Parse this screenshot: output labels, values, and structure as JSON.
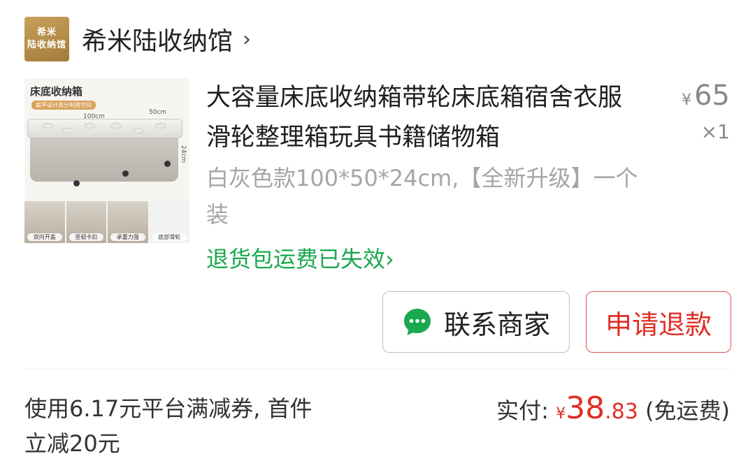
{
  "shop": {
    "logo_line1": "希米",
    "logo_line2": "陆收纳馆",
    "name": "希米陆收纳馆",
    "chevron": "›"
  },
  "product": {
    "image": {
      "title": "床底收纳箱",
      "subtitle": "扁平设计充分利用空间",
      "dim_length": "100cm",
      "dim_width": "50cm",
      "dim_height": "24cm",
      "thumbs": [
        "双向开盖",
        "坚韧卡扣",
        "承重力强",
        "底部滑轮"
      ]
    },
    "title": "大容量床底收纳箱带轮床底箱宿舍衣服滑轮整理箱玩具书籍储物箱",
    "currency": "¥",
    "unit_price": "65",
    "quantity": "×1",
    "spec": "白灰色款100*50*24cm,【全新升级】一个装",
    "return_notice": "退货包运费已失效",
    "return_chevron": "›"
  },
  "actions": {
    "contact_label": "联系商家",
    "contact_icon": "chat-bubble-icon",
    "refund_label": "申请退款"
  },
  "footer": {
    "coupon_text": "使用6.17元平台满减券, 首件立减20元",
    "paid_label": "实付:",
    "currency": "¥",
    "paid_integer": "38",
    "paid_decimal": ".83",
    "shipping_note": "(免运费)"
  },
  "colors": {
    "accent_red": "#e02e24",
    "green": "#1aa84e",
    "gray_text": "#a5a5a5"
  }
}
